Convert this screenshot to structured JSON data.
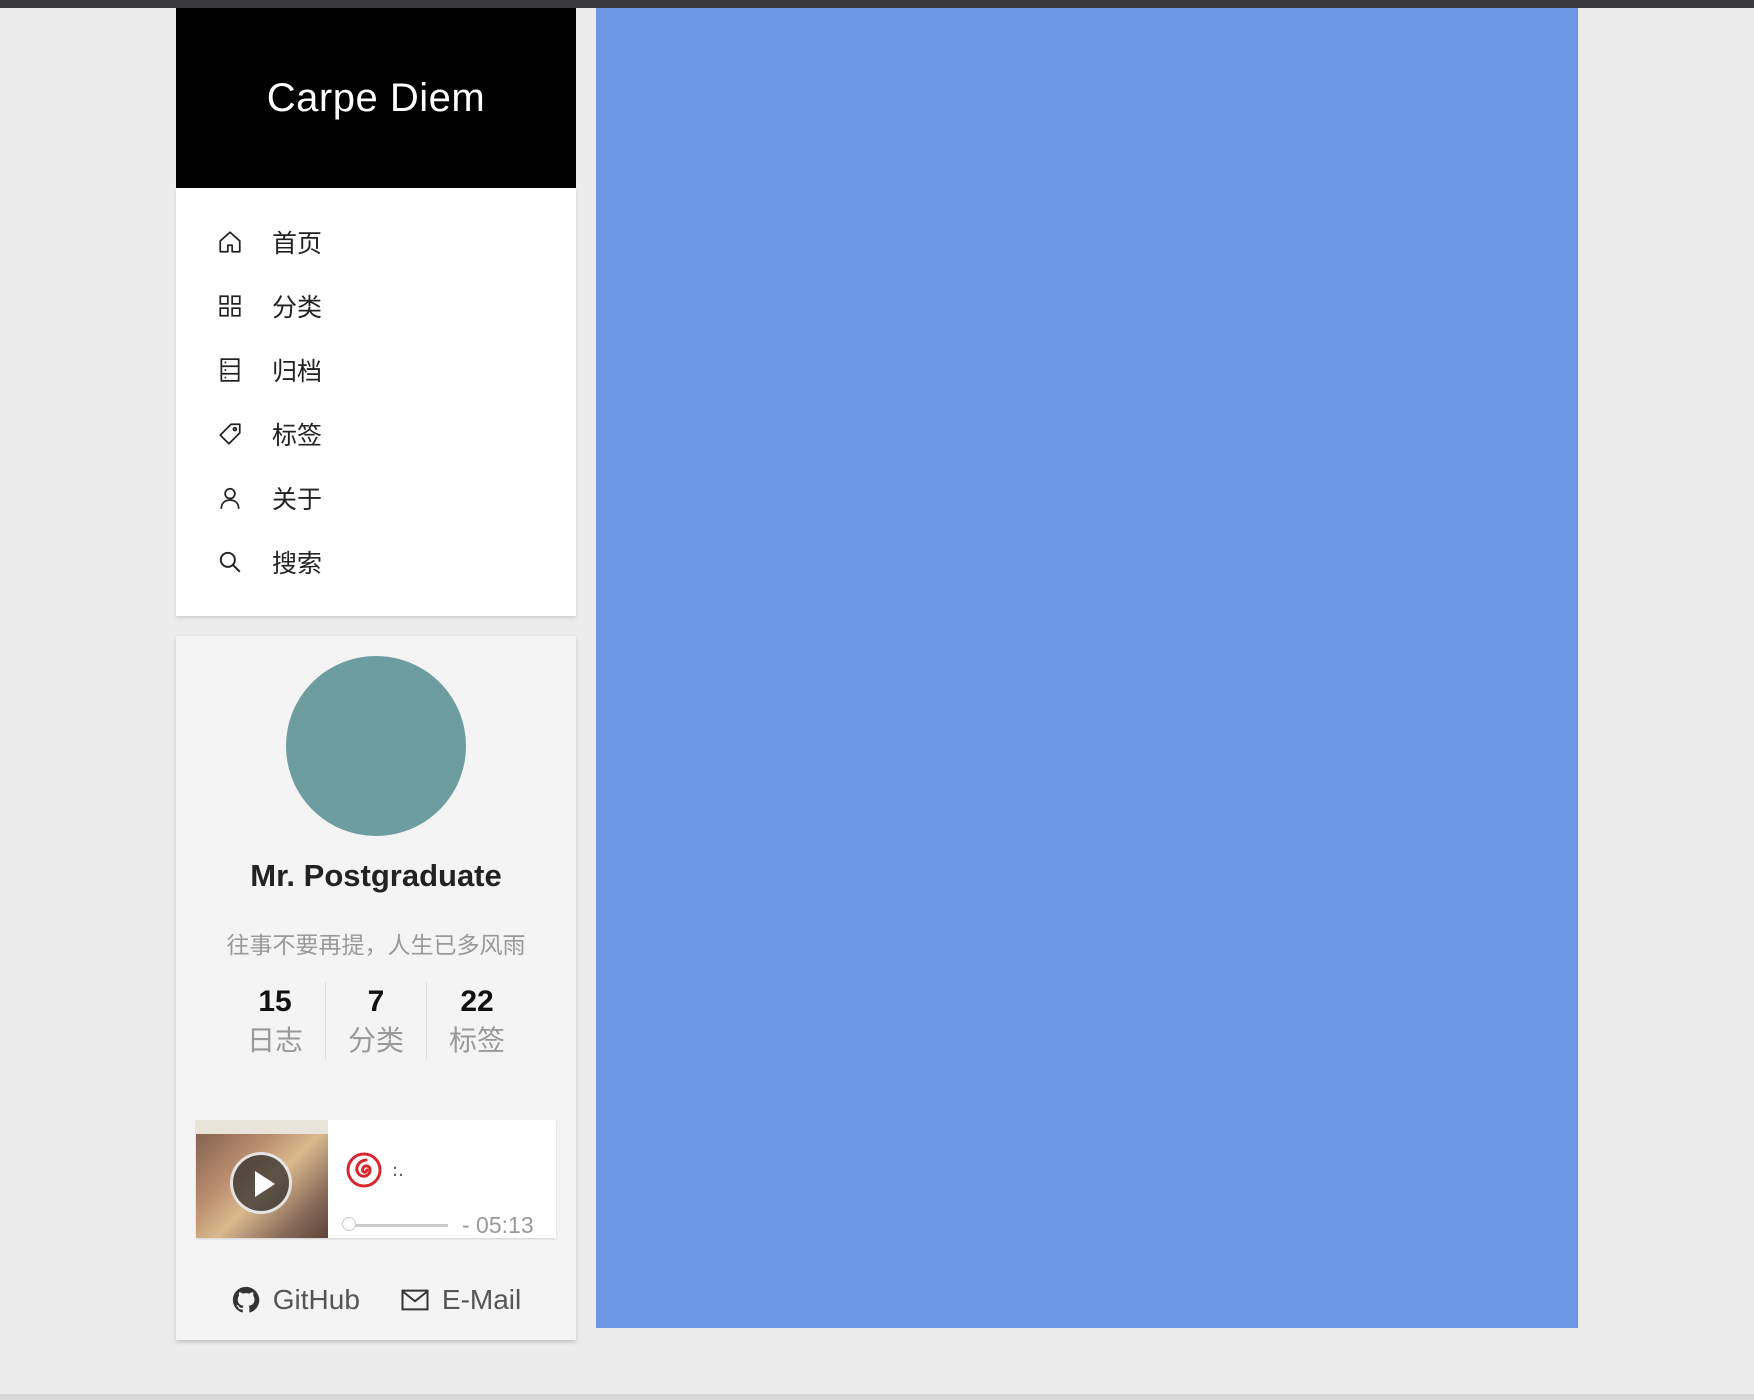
{
  "site": {
    "title": "Carpe Diem"
  },
  "menu": {
    "items": [
      {
        "label": "首页",
        "icon": "home-icon"
      },
      {
        "label": "分类",
        "icon": "grid-icon"
      },
      {
        "label": "归档",
        "icon": "archive-icon"
      },
      {
        "label": "标签",
        "icon": "tag-icon"
      },
      {
        "label": "关于",
        "icon": "user-icon"
      },
      {
        "label": "搜索",
        "icon": "search-icon"
      }
    ]
  },
  "profile": {
    "name": "Mr. Postgraduate",
    "motto": "往事不要再提，人生已多风雨",
    "avatar_color": "#6e9d9f",
    "stats": [
      {
        "count": "15",
        "label": "日志"
      },
      {
        "count": "7",
        "label": "分类"
      },
      {
        "count": "22",
        "label": "标签"
      }
    ]
  },
  "player": {
    "title": ":.",
    "duration": "- 05:13",
    "progress": 0,
    "brand_icon": "netease-music-icon"
  },
  "links": [
    {
      "label": "GitHub",
      "icon": "github-icon"
    },
    {
      "label": "E-Mail",
      "icon": "mail-icon"
    }
  ],
  "colors": {
    "header_bg": "#000000",
    "content_bg": "#6d96e4",
    "page_bg": "#ececec"
  }
}
